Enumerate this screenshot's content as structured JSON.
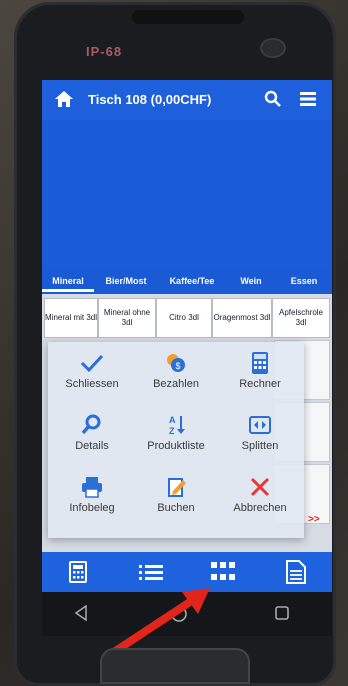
{
  "device": {
    "badge": "IP-68"
  },
  "header": {
    "title": "Tisch 108 (0,00CHF)",
    "home_icon": "home-icon",
    "search_icon": "search-icon",
    "menu_icon": "hamburger-menu-icon"
  },
  "categories": [
    {
      "label": "Mineral",
      "active": true
    },
    {
      "label": "Bier/Most",
      "active": false
    },
    {
      "label": "Kaffee/Tee",
      "active": false
    },
    {
      "label": "Wein",
      "active": false
    },
    {
      "label": "Essen",
      "active": false
    }
  ],
  "products": [
    {
      "label": "Mineral mit 3dl"
    },
    {
      "label": "Mineral ohne 3dl"
    },
    {
      "label": "Citro 3dl"
    },
    {
      "label": "Oragenmost 3dl"
    },
    {
      "label": "Apfelschrole 3dl"
    }
  ],
  "actions": [
    {
      "label": "Schliessen",
      "icon": "checkmark-icon"
    },
    {
      "label": "Bezahlen",
      "icon": "coins-icon"
    },
    {
      "label": "Rechner",
      "icon": "calculator-icon"
    },
    {
      "label": "Details",
      "icon": "magnifier-icon"
    },
    {
      "label": "Produktliste",
      "icon": "sort-az-icon"
    },
    {
      "label": "Splitten",
      "icon": "split-icon"
    },
    {
      "label": "Infobeleg",
      "icon": "printer-icon"
    },
    {
      "label": "Buchen",
      "icon": "edit-document-icon"
    },
    {
      "label": "Abbrechen",
      "icon": "close-icon"
    }
  ],
  "more_indicator": ">>",
  "bottom_bar": [
    {
      "icon": "calculator-icon"
    },
    {
      "icon": "list-icon"
    },
    {
      "icon": "grid-icon"
    },
    {
      "icon": "document-icon"
    }
  ],
  "colors": {
    "primary": "#1e60db",
    "highlight_red": "#e2241b",
    "close_red": "#e53935"
  }
}
